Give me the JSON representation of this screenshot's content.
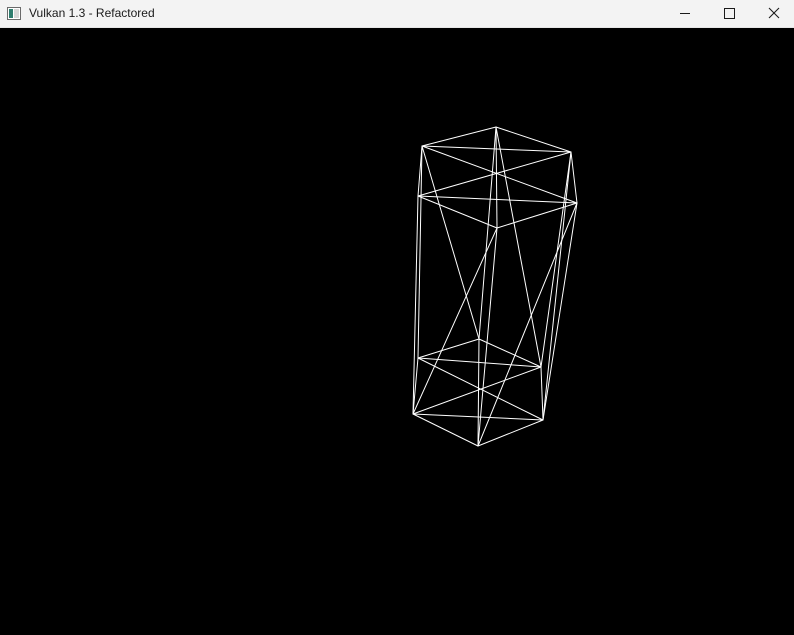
{
  "window": {
    "title": "Vulkan 1.3 - Refactored",
    "app_icon": "app-window-icon",
    "controls": {
      "minimize_icon": "minimize-icon",
      "maximize_icon": "maximize-icon",
      "close_icon": "close-icon"
    }
  },
  "viewport": {
    "background_color": "#000000",
    "wireframe_color": "#ffffff",
    "object": "wireframe-box"
  }
}
